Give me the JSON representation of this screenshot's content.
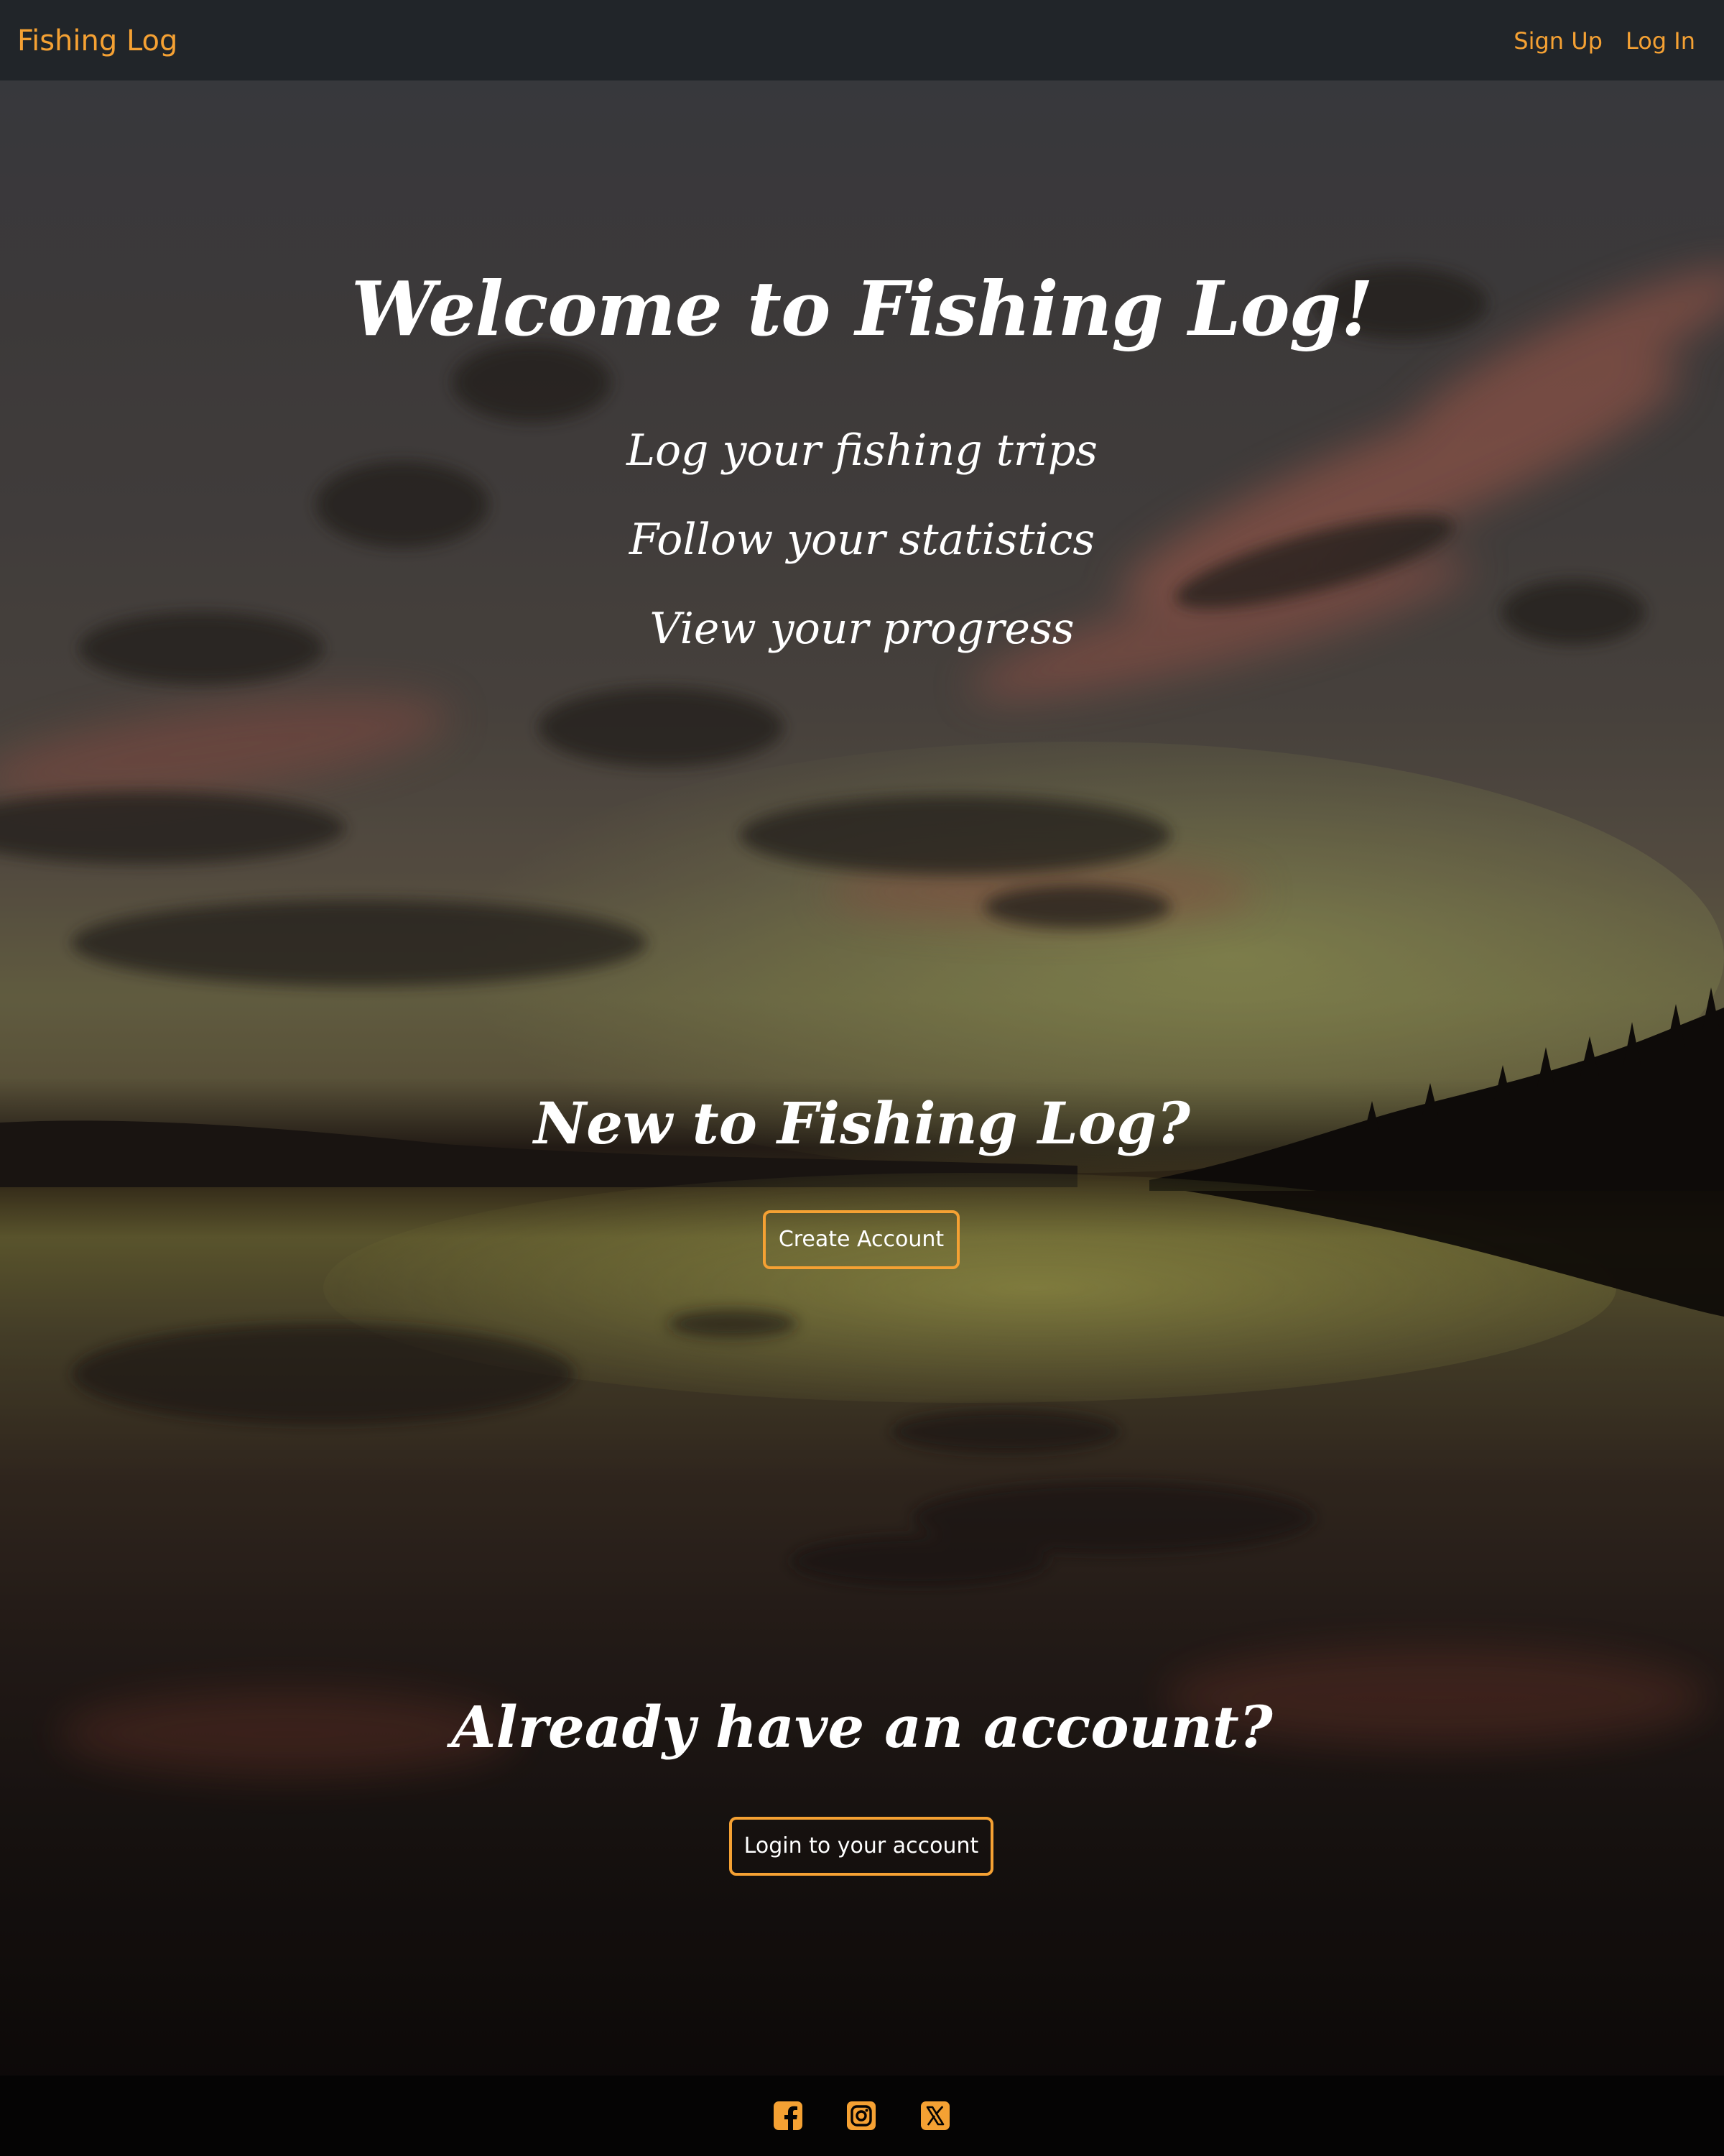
{
  "navbar": {
    "brand": "Fishing Log",
    "links": [
      {
        "label": "Sign Up"
      },
      {
        "label": "Log In"
      }
    ]
  },
  "hero": {
    "headline": "Welcome to Fishing Log!",
    "taglines": [
      "Log your fishing trips",
      "Follow your statistics",
      "View your progress"
    ],
    "new_user": {
      "title": "New to Fishing Log?",
      "button_label": "Create Account"
    },
    "returning_user": {
      "title": "Already have an account?",
      "button_label": "Login to your account"
    }
  },
  "footer": {
    "social_icons": [
      "facebook-icon",
      "instagram-icon",
      "x-icon"
    ]
  },
  "colors": {
    "accent": "#f5a133",
    "navbar_bg": "#212529",
    "footer_bg": "#050404",
    "text": "#ffffff"
  }
}
